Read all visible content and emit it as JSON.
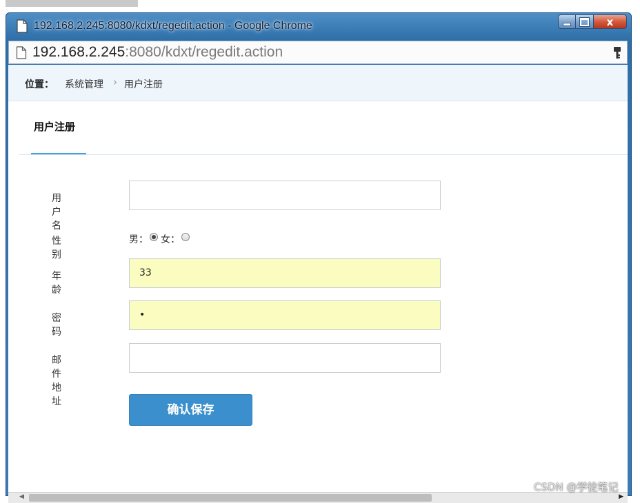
{
  "window": {
    "title": "192.168.2.245:8080/kdxt/regedit.action - Google Chrome",
    "controls": {
      "minimize_icon": "minimize-icon",
      "maximize_icon": "maximize-icon",
      "close_label": "x"
    }
  },
  "addressbar": {
    "host": "192.168.2.245",
    "port": ":8080",
    "path": "/kdxt/regedit.action",
    "page_icon": "page-icon",
    "key_icon": "key-icon"
  },
  "breadcrumb": {
    "label": "位置：",
    "items": [
      "系统管理",
      "用户注册"
    ],
    "separator": "›"
  },
  "tab": {
    "label": "用户注册",
    "accent": "#3ea2dc"
  },
  "form": {
    "username": {
      "label": "用户名",
      "value": ""
    },
    "gender": {
      "label": "性别",
      "options": [
        {
          "label": "男：",
          "selected": true
        },
        {
          "label": "女：",
          "selected": false
        }
      ]
    },
    "age": {
      "label": "年龄",
      "value": "33"
    },
    "password": {
      "label": "密码",
      "value": "•"
    },
    "email": {
      "label": "邮件地址",
      "value": ""
    },
    "submit_label": "确认保存",
    "autofill_color": "#fbfdc0",
    "button_color": "#3b8fcc"
  },
  "scrollbar": {
    "left_arrow": "◀",
    "right_arrow": "▶"
  },
  "watermark": "CSDN @学徒笔记"
}
